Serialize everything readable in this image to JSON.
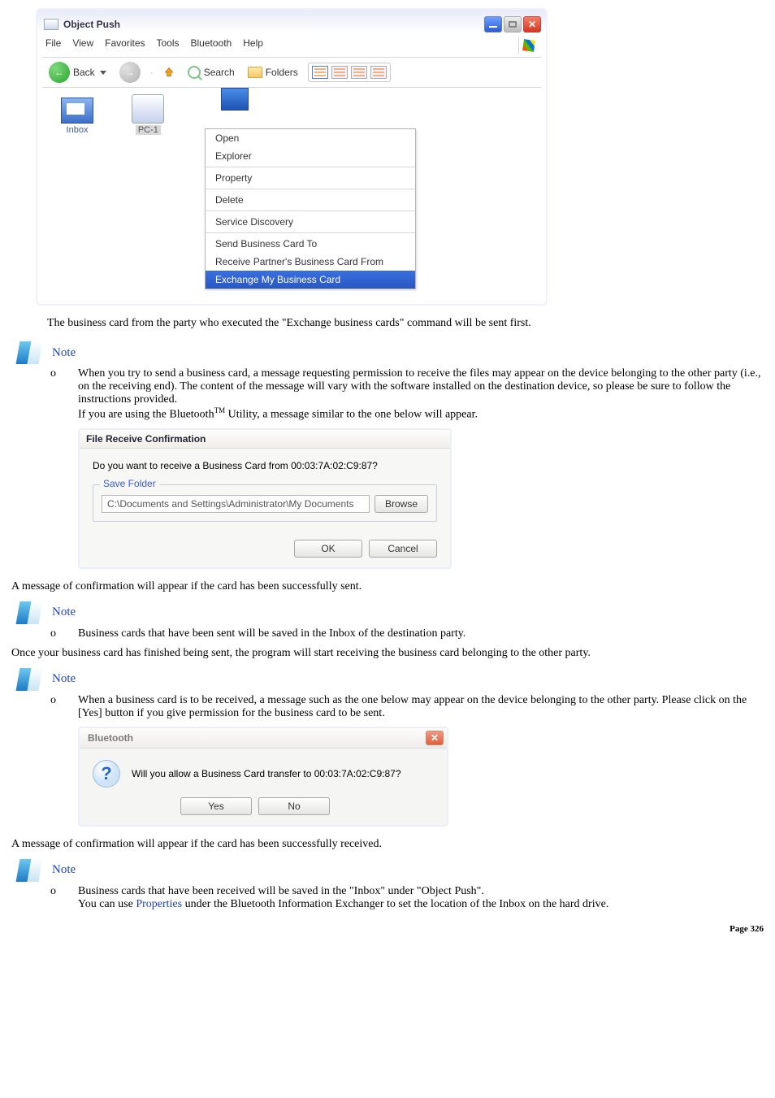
{
  "object_push_window": {
    "title": "Object Push",
    "menu": {
      "file": "File",
      "view": "View",
      "favorites": "Favorites",
      "tools": "Tools",
      "bluetooth": "Bluetooth",
      "help": "Help"
    },
    "toolbar": {
      "back": "Back",
      "search": "Search",
      "folders": "Folders"
    },
    "items": {
      "inbox": "Inbox",
      "pc1": "PC-1"
    },
    "context_menu": {
      "open": "Open",
      "explorer": "Explorer",
      "property": "Property",
      "delete": "Delete",
      "service_discovery": "Service Discovery",
      "send_card_to": "Send Business Card To",
      "receive_card_from": "Receive Partner's Business Card From",
      "exchange_card": "Exchange My Business Card"
    }
  },
  "body_text": {
    "after_window": "The business card from the party who executed the \"Exchange business cards\" command will be sent first.",
    "confirm_sent": "A message of confirmation will appear if the card has been successfully sent.",
    "after_sent_para": "Once your business card has finished being sent, the program will start receiving the business card belonging to the other party.",
    "confirm_received": "A message of confirmation will appear if the card has been successfully received."
  },
  "note_label": "Note",
  "note1": {
    "line1": "When you try to send a business card, a message requesting permission to receive the files may appear on the device belonging to the other party (i.e., on the receiving end). The content of the message will vary with the software installed on the destination device, so please be sure to follow the instructions provided.",
    "line2_a": "If you are using the Bluetooth",
    "line2_tm": "TM",
    "line2_b": " Utility, a message similar to the one below will appear."
  },
  "file_receive_dialog": {
    "title": "File Receive Confirmation",
    "prompt": "Do you want to receive a Business Card from 00:03:7A:02:C9:87?",
    "save_folder_legend": "Save Folder",
    "path": "C:\\Documents and Settings\\Administrator\\My Documents",
    "browse": "Browse",
    "ok": "OK",
    "cancel": "Cancel"
  },
  "note2": {
    "text": "Business cards that have been sent will be saved in the Inbox of the destination party."
  },
  "note3": {
    "text": "When a business card is to be received, a message such as the one below may appear on the device belonging to the other party. Please click on the [Yes] button if you give permission for the business card to be sent."
  },
  "bt_prompt": {
    "title": "Bluetooth",
    "message": "Will you allow a Business Card transfer to 00:03:7A:02:C9:87?",
    "yes": "Yes",
    "no": "No"
  },
  "note4": {
    "line1": "Business cards that have been received will be saved in the \"Inbox\" under \"Object Push\".",
    "line2_a": "You can use ",
    "line2_link": "Properties",
    "line2_b": " under the Bluetooth Information Exchanger to set the location of the Inbox on the hard drive."
  },
  "page_footer": "Page 326"
}
